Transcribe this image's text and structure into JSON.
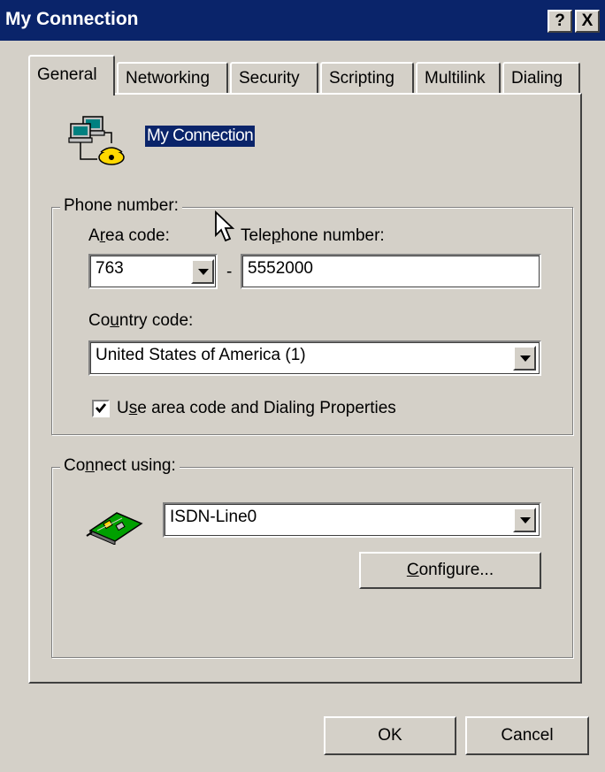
{
  "window": {
    "title": "My Connection",
    "help_label": "?",
    "close_label": "X"
  },
  "tabs": [
    {
      "label": "General",
      "active": true
    },
    {
      "label": "Networking",
      "active": false
    },
    {
      "label": "Security",
      "active": false
    },
    {
      "label": "Scripting",
      "active": false
    },
    {
      "label": "Multilink",
      "active": false
    },
    {
      "label": "Dialing",
      "active": false
    }
  ],
  "general": {
    "connection_name": "My Connection",
    "phone_group_label": "Phone number:",
    "area_code_label": {
      "pre": "A",
      "u": "r",
      "post": "ea code:"
    },
    "area_code_value": "763",
    "dash": "-",
    "telephone_label": {
      "pre": "Tele",
      "u": "p",
      "post": "hone number:"
    },
    "telephone_value": "5552000",
    "country_code_label": {
      "pre": "Co",
      "u": "u",
      "post": "ntry code:"
    },
    "country_code_value": "United States of America (1)",
    "use_area_code": {
      "checked": true,
      "label_pre": "U",
      "label_u": "s",
      "label_post": "e area code and Dialing Properties"
    },
    "connect_group_label": {
      "pre": "Co",
      "u": "n",
      "post": "nect using:"
    },
    "device_value": "ISDN-Line0",
    "configure_label": {
      "pre": "",
      "u": "C",
      "post": "onfigure..."
    }
  },
  "footer": {
    "ok_label": "OK",
    "cancel_label": "Cancel"
  },
  "icons": [
    "network-connection-icon",
    "isdn-adapter-icon",
    "mouse-cursor-icon",
    "checkmark-icon"
  ]
}
